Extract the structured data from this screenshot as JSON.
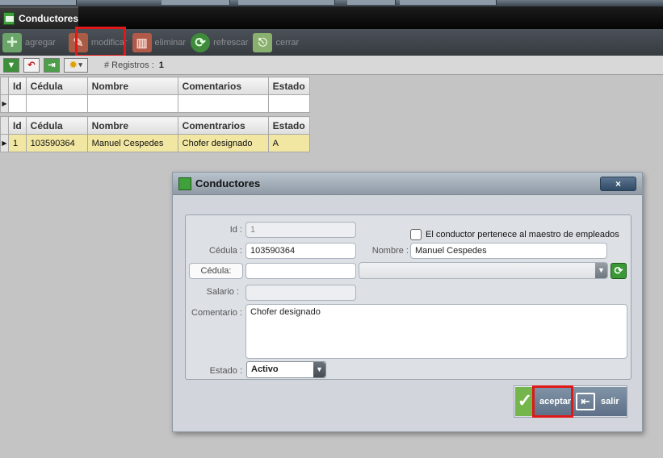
{
  "window": {
    "tab_title": "Conductores"
  },
  "toolbar": {
    "add_label": "agregar",
    "edit_label": "modificar",
    "delete_label": "eliminar",
    "refresh_label": "refrescar",
    "close_label": "cerrar"
  },
  "subbar": {
    "records_label": "# Registros :",
    "records_count": "1"
  },
  "grid": {
    "columns": [
      "Id",
      "Cédula",
      "Nombre",
      "Comentrarios",
      "Estado"
    ],
    "filter_columns": [
      "Id",
      "Cédula",
      "Nombre",
      "Comentarios",
      "Estado"
    ],
    "rows": [
      {
        "id": "1",
        "cedula": "103590364",
        "nombre": "Manuel Cespedes",
        "comentarios": "Chofer designado",
        "estado": "A"
      }
    ]
  },
  "dialog": {
    "title": "Conductores",
    "close_glyph": "×",
    "id_label": "Id :",
    "id_value": "1",
    "cedula_label": "Cédula :",
    "cedula_value": "103590364",
    "nombre_label": "Nombre :",
    "nombre_value": "Manuel Cespedes",
    "employee_checkbox_label": "El conductor pertenece al maestro de empleados",
    "cedula_search_label": "Cédula:",
    "salario_label": "Salario :",
    "comentario_label": "Comentario :",
    "comentario_value": "Chofer designado",
    "estado_label": "Estado :",
    "estado_value": "Activo",
    "accept_label": "aceptar",
    "exit_label": "salir"
  },
  "colors": {
    "highlight": "#e01818",
    "selected_row": "#f2e7a2",
    "accent_green": "#3a9836"
  }
}
